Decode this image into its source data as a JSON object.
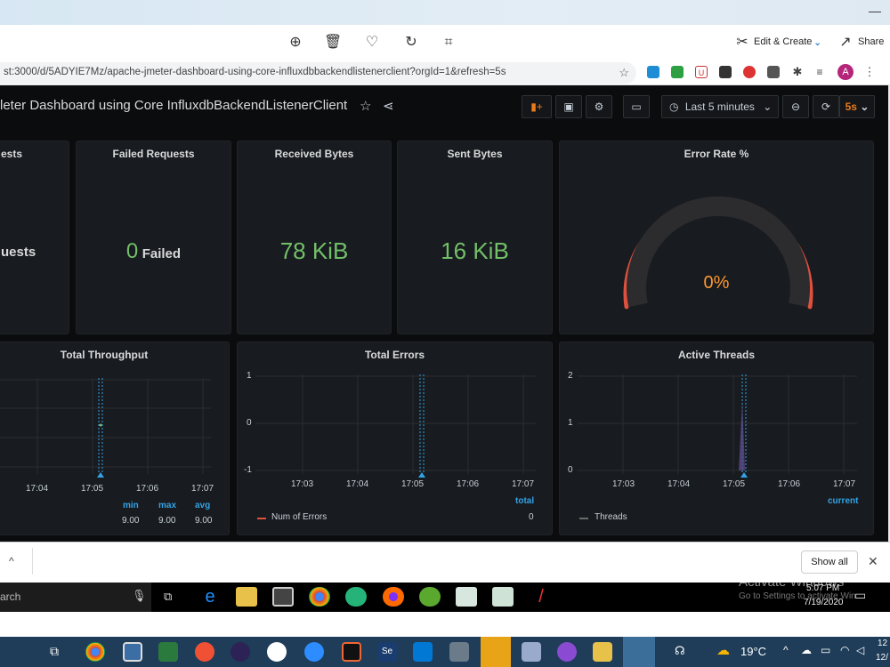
{
  "viewer": {
    "edit_create": "Edit & Create",
    "share": "Share"
  },
  "browser": {
    "url": "st:3000/d/5ADYIE7Mz/apache-jmeter-dashboard-using-core-influxdbbackendlistenerclient?orgId=1&refresh=5s",
    "avatar": "A"
  },
  "dashboard": {
    "title": "leter Dashboard using Core InfluxdbBackendListenerClient",
    "time_range": "Last 5 minutes",
    "refresh": "5s"
  },
  "stats": [
    {
      "title": "ests",
      "value": "uests",
      "unit": ""
    },
    {
      "title": "Failed Requests",
      "value": "0",
      "unit": "Failed"
    },
    {
      "title": "Received Bytes",
      "value": "78 KiB",
      "unit": ""
    },
    {
      "title": "Sent Bytes",
      "value": "16 KiB",
      "unit": ""
    }
  ],
  "gauge": {
    "title": "Error Rate %",
    "value": "0%"
  },
  "graphs": {
    "throughput": {
      "title": "Total Throughput",
      "x_ticks": [
        "17:04",
        "17:05",
        "17:06",
        "17:07"
      ],
      "legend_headers": [
        "min",
        "max",
        "avg"
      ],
      "legend_values": [
        "9.00",
        "9.00",
        "9.00"
      ]
    },
    "errors": {
      "title": "Total Errors",
      "y_ticks": [
        "1",
        "0",
        "-1"
      ],
      "x_ticks": [
        "17:03",
        "17:04",
        "17:05",
        "17:06",
        "17:07"
      ],
      "legend_header": "total",
      "series": "Num of Errors",
      "legend_value": "0"
    },
    "threads": {
      "title": "Active Threads",
      "y_ticks": [
        "2",
        "1",
        "0"
      ],
      "x_ticks": [
        "17:03",
        "17:04",
        "17:05",
        "17:06",
        "17:07"
      ],
      "legend_header": "current",
      "series": "Threads"
    }
  },
  "shelf": {
    "show_all": "Show all"
  },
  "inner_taskbar": {
    "search": "arch",
    "watermark_1": "Activate Windows",
    "watermark_2": "Go to Settings to activate Win",
    "time": "5:07 PM",
    "date": "7/19/2020"
  },
  "outer_taskbar": {
    "temperature": "19°C",
    "time": "12",
    "date": "12/"
  },
  "colors": {
    "grafana_bg": "#0b0c0e",
    "panel_bg": "#181b1f",
    "stat_green": "#73bf69",
    "gauge_red": "#e0503d",
    "gauge_value": "#ff9830",
    "legend_blue": "#33a2e5"
  }
}
